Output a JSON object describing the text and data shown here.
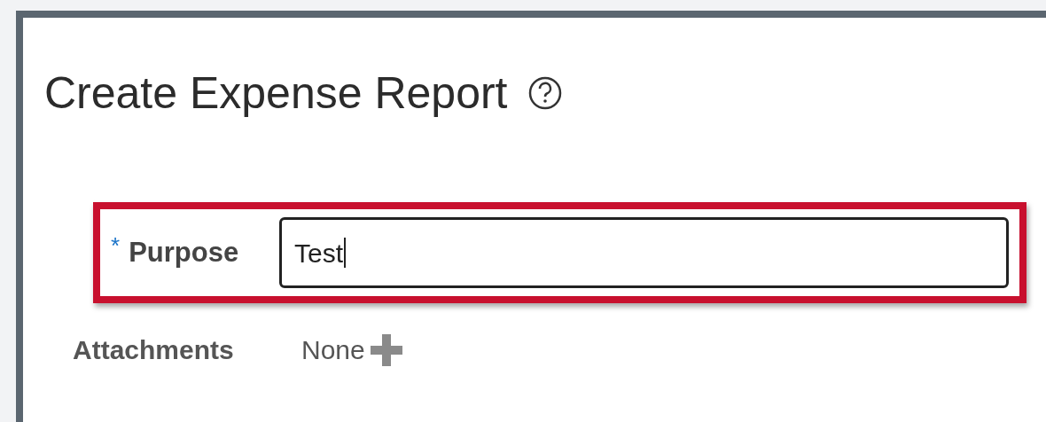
{
  "page": {
    "title": "Create Expense Report"
  },
  "purpose": {
    "label": "Purpose",
    "required": true,
    "required_mark": "*",
    "value": "Test",
    "highlighted": true
  },
  "attachments": {
    "label": "Attachments",
    "value": "None"
  }
}
